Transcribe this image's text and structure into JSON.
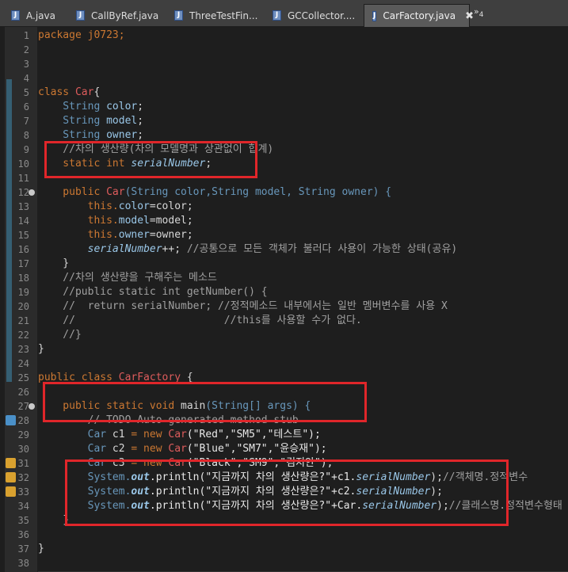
{
  "tabs": [
    {
      "label": "A.java",
      "active": false
    },
    {
      "label": "CallByRef.java",
      "active": false
    },
    {
      "label": "ThreeTestFin...",
      "active": false
    },
    {
      "label": "GCCollector....",
      "active": false
    },
    {
      "label": "CarFactory.java",
      "active": true
    }
  ],
  "overflow_label": "»",
  "overflow_count": "4",
  "close_glyph": "✖",
  "line_numbers": [
    "1",
    "2",
    "3",
    "4",
    "5",
    "6",
    "7",
    "8",
    "9",
    "10",
    "11",
    "12",
    "13",
    "14",
    "15",
    "16",
    "17",
    "18",
    "19",
    "20",
    "21",
    "22",
    "23",
    "24",
    "25",
    "26",
    "27",
    "28",
    "29",
    "30",
    "31",
    "32",
    "33",
    "34",
    "35",
    "36",
    "37",
    "38"
  ],
  "code": {
    "l1": "package j0723;",
    "l5_a": "class ",
    "l5_b": "Car",
    "l5_c": "{",
    "l6_a": "    String ",
    "l6_b": "color",
    "l6_c": ";",
    "l7_a": "    String ",
    "l7_b": "model",
    "l7_c": ";",
    "l8_a": "    String ",
    "l8_b": "owner",
    "l8_c": ";",
    "l9": "    //차의 생산량(차의 모델명과 상관없이 합계)",
    "l10_a": "    static int ",
    "l10_b": "serialNumber",
    "l10_c": ";",
    "l12_a": "    public ",
    "l12_b": "Car",
    "l12_c": "(String color,String model, String owner) {",
    "l13_a": "        this.",
    "l13_b": "color",
    "l13_c": "=color;",
    "l14_a": "        this.",
    "l14_b": "model",
    "l14_c": "=model;",
    "l15_a": "        this.",
    "l15_b": "owner",
    "l15_c": "=owner;",
    "l16_a": "        ",
    "l16_b": "serialNumber",
    "l16_c": "++; ",
    "l16_d": "//공통으로 모든 객체가 불러다 사용이 가능한 상태(공유)",
    "l17": "    }",
    "l18": "    //차의 생산량을 구해주는 메소드",
    "l19": "    //public static int getNumber() {",
    "l20": "    //  return serialNumber; //정적메소드 내부에서는 일반 멤버변수를 사용 X",
    "l21": "    //                        //this를 사용할 수가 없다.",
    "l22": "    //}",
    "l23": "}",
    "l25_a": "public class ",
    "l25_b": "CarFactory",
    "l25_c": " {",
    "l27_a": "    public static void ",
    "l27_b": "main",
    "l27_c": "(String[] args) {",
    "l28": "        // TODO Auto-generated method stub",
    "l29_a": "        Car ",
    "l29_b": "c1",
    "l29_c": " = new ",
    "l29_d": "Car",
    "l29_e": "(\"Red\",\"SM5\",\"테스트\");",
    "l30_a": "        Car ",
    "l30_b": "c2",
    "l30_c": " = new ",
    "l30_d": "Car",
    "l30_e": "(\"Blue\",\"SM7\",\"윤승재\");",
    "l31_a": "        Car ",
    "l31_b": "c3",
    "l31_c": " = new ",
    "l31_d": "Car",
    "l31_e": "(\"Black\",\"SM9\",\"김지안\");",
    "l32_a": "        System.",
    "l32_b": "out",
    "l32_c": ".println(\"지금까지 차의 생산량은?\"+c1.",
    "l32_d": "serialNumber",
    "l32_e": ");",
    "l32_f": "//객체명.정적변수",
    "l33_a": "        System.",
    "l33_b": "out",
    "l33_c": ".println(\"지금까지 차의 생산량은?\"+c2.",
    "l33_d": "serialNumber",
    "l33_e": ");",
    "l34_a": "        System.",
    "l34_b": "out",
    "l34_c": ".println(\"지금까지 차의 생산량은?\"+Car.",
    "l34_d": "serialNumber",
    "l34_e": ");",
    "l34_f": "//클래스명.정적변수형태",
    "l35": "    }",
    "l37": "}"
  },
  "colors": {
    "highlight_box": "#e0262a",
    "keyword": "#cc7832",
    "type": "#6897bb",
    "class_name": "#de5c5c"
  }
}
